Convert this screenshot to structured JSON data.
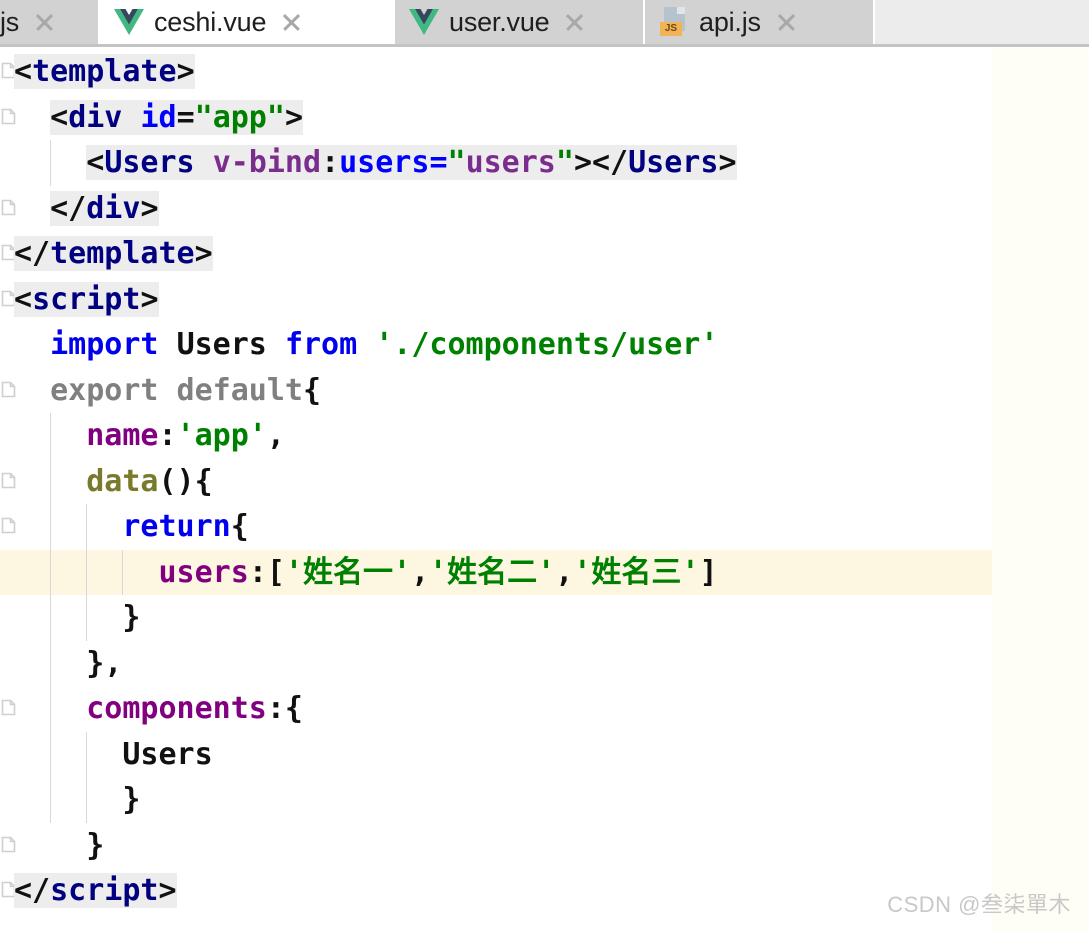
{
  "tabs": [
    {
      "label": "js",
      "icon": "partial-tab",
      "active": false,
      "partial": true,
      "closable": true
    },
    {
      "label": "ceshi.vue",
      "icon": "vue-icon",
      "active": true,
      "partial": false,
      "closable": true
    },
    {
      "label": "user.vue",
      "icon": "vue-icon",
      "active": false,
      "partial": false,
      "closable": true
    },
    {
      "label": "api.js",
      "icon": "js-icon",
      "active": false,
      "partial": false,
      "closable": true
    }
  ],
  "editor": {
    "language": "vue",
    "highlighted_line": 9,
    "lines": [
      {
        "n": 1,
        "fold": true,
        "indent_guides": [],
        "highlight": false,
        "tokens": [
          {
            "t": "<",
            "c": "bracket",
            "bg": true
          },
          {
            "t": "template",
            "c": "tag",
            "bg": true
          },
          {
            "t": ">",
            "c": "bracket",
            "bg": true
          }
        ]
      },
      {
        "n": 2,
        "fold": true,
        "indent_guides": [],
        "highlight": false,
        "tokens": [
          {
            "t": "  ",
            "c": "plain"
          },
          {
            "t": "<",
            "c": "bracket",
            "bg": true
          },
          {
            "t": "div",
            "c": "tag",
            "bg": true
          },
          {
            "t": " ",
            "c": "plain",
            "bg": true
          },
          {
            "t": "id",
            "c": "attr",
            "bg": true
          },
          {
            "t": "=",
            "c": "punct",
            "bg": true
          },
          {
            "t": "\"",
            "c": "attrval",
            "bg": true
          },
          {
            "t": "app",
            "c": "attrval",
            "bg": true
          },
          {
            "t": "\"",
            "c": "attrval",
            "bg": true
          },
          {
            "t": ">",
            "c": "bracket",
            "bg": true
          }
        ]
      },
      {
        "n": 3,
        "fold": false,
        "indent_guides": [
          1
        ],
        "highlight": false,
        "tokens": [
          {
            "t": "    ",
            "c": "plain"
          },
          {
            "t": "<",
            "c": "bracket",
            "bg": true
          },
          {
            "t": "Users",
            "c": "tag",
            "bg": true
          },
          {
            "t": " ",
            "c": "plain",
            "bg": true
          },
          {
            "t": "v-bind",
            "c": "directive",
            "bg": true
          },
          {
            "t": ":",
            "c": "punct",
            "bg": true
          },
          {
            "t": "users",
            "c": "attr",
            "bg": true
          },
          {
            "t": "=",
            "c": "attr",
            "bg": true
          },
          {
            "t": "\"",
            "c": "attrval",
            "bg": true
          },
          {
            "t": "users",
            "c": "dirval",
            "bg": true
          },
          {
            "t": "\"",
            "c": "attrval",
            "bg": true
          },
          {
            "t": ">",
            "c": "bracket",
            "bg": true
          },
          {
            "t": "</",
            "c": "bracket",
            "bg": true
          },
          {
            "t": "Users",
            "c": "tag",
            "bg": true
          },
          {
            "t": ">",
            "c": "bracket",
            "bg": true
          }
        ]
      },
      {
        "n": 4,
        "fold": true,
        "indent_guides": [],
        "highlight": false,
        "tokens": [
          {
            "t": "  ",
            "c": "plain"
          },
          {
            "t": "</",
            "c": "bracket",
            "bg": true
          },
          {
            "t": "div",
            "c": "tag",
            "bg": true
          },
          {
            "t": ">",
            "c": "bracket",
            "bg": true
          }
        ]
      },
      {
        "n": 5,
        "fold": true,
        "indent_guides": [],
        "highlight": false,
        "tokens": [
          {
            "t": "</",
            "c": "bracket",
            "bg": true
          },
          {
            "t": "template",
            "c": "tag",
            "bg": true
          },
          {
            "t": ">",
            "c": "bracket",
            "bg": true
          }
        ]
      },
      {
        "n": 6,
        "fold": true,
        "indent_guides": [],
        "highlight": false,
        "tokens": [
          {
            "t": "<",
            "c": "bracket",
            "bg": true
          },
          {
            "t": "script",
            "c": "tag",
            "bg": true
          },
          {
            "t": ">",
            "c": "bracket",
            "bg": true
          }
        ]
      },
      {
        "n": 7,
        "fold": false,
        "indent_guides": [],
        "highlight": false,
        "tokens": [
          {
            "t": "  ",
            "c": "plain"
          },
          {
            "t": "import",
            "c": "kw"
          },
          {
            "t": " ",
            "c": "plain"
          },
          {
            "t": "Users",
            "c": "plain"
          },
          {
            "t": " ",
            "c": "plain"
          },
          {
            "t": "from",
            "c": "kw"
          },
          {
            "t": " ",
            "c": "plain"
          },
          {
            "t": "'./components/user'",
            "c": "str"
          }
        ]
      },
      {
        "n": 8,
        "fold": true,
        "indent_guides": [],
        "highlight": false,
        "tokens": [
          {
            "t": "  ",
            "c": "plain"
          },
          {
            "t": "export default",
            "c": "dim"
          },
          {
            "t": "{",
            "c": "punct"
          }
        ]
      },
      {
        "n": 9,
        "fold": false,
        "indent_guides": [
          1
        ],
        "highlight": false,
        "tokens": [
          {
            "t": "    ",
            "c": "plain"
          },
          {
            "t": "name",
            "c": "prop"
          },
          {
            "t": ":",
            "c": "punct"
          },
          {
            "t": "'app'",
            "c": "str"
          },
          {
            "t": ",",
            "c": "punct"
          }
        ]
      },
      {
        "n": 10,
        "fold": true,
        "indent_guides": [
          1
        ],
        "highlight": false,
        "tokens": [
          {
            "t": "    ",
            "c": "plain"
          },
          {
            "t": "data",
            "c": "fn"
          },
          {
            "t": "(){",
            "c": "punct"
          }
        ]
      },
      {
        "n": 11,
        "fold": true,
        "indent_guides": [
          1,
          2
        ],
        "highlight": false,
        "tokens": [
          {
            "t": "      ",
            "c": "plain"
          },
          {
            "t": "return",
            "c": "kw"
          },
          {
            "t": "{",
            "c": "punct"
          }
        ]
      },
      {
        "n": 12,
        "fold": false,
        "indent_guides": [
          1,
          2,
          3
        ],
        "highlight": true,
        "tokens": [
          {
            "t": "        ",
            "c": "plain"
          },
          {
            "t": "users",
            "c": "prop"
          },
          {
            "t": ":[",
            "c": "punct"
          },
          {
            "t": "'姓名一'",
            "c": "str"
          },
          {
            "t": ",",
            "c": "punct"
          },
          {
            "t": "'姓名二'",
            "c": "str"
          },
          {
            "t": ",",
            "c": "punct"
          },
          {
            "t": "'姓名三'",
            "c": "str"
          },
          {
            "t": "]",
            "c": "punct"
          }
        ]
      },
      {
        "n": 13,
        "fold": false,
        "indent_guides": [
          1,
          2
        ],
        "highlight": false,
        "tokens": [
          {
            "t": "      }",
            "c": "punct"
          }
        ]
      },
      {
        "n": 14,
        "fold": false,
        "indent_guides": [
          1
        ],
        "highlight": false,
        "tokens": [
          {
            "t": "    },",
            "c": "punct"
          }
        ]
      },
      {
        "n": 15,
        "fold": true,
        "indent_guides": [
          1
        ],
        "highlight": false,
        "tokens": [
          {
            "t": "    ",
            "c": "plain"
          },
          {
            "t": "components",
            "c": "prop"
          },
          {
            "t": ":{",
            "c": "punct"
          }
        ]
      },
      {
        "n": 16,
        "fold": false,
        "indent_guides": [
          1,
          2
        ],
        "highlight": false,
        "tokens": [
          {
            "t": "      ",
            "c": "plain"
          },
          {
            "t": "Users",
            "c": "plain"
          }
        ]
      },
      {
        "n": 17,
        "fold": false,
        "indent_guides": [
          1,
          2
        ],
        "highlight": false,
        "tokens": [
          {
            "t": "      }",
            "c": "punct"
          }
        ]
      },
      {
        "n": 18,
        "fold": true,
        "indent_guides": [],
        "highlight": false,
        "tokens": [
          {
            "t": "    }",
            "c": "punct"
          }
        ]
      },
      {
        "n": 19,
        "fold": true,
        "indent_guides": [],
        "highlight": false,
        "tokens": [
          {
            "t": "</",
            "c": "bracket",
            "bg": true
          },
          {
            "t": "script",
            "c": "tag",
            "bg": true
          },
          {
            "t": ">",
            "c": "bracket",
            "bg": true
          }
        ]
      }
    ]
  },
  "watermark": {
    "text": "CSDN @叁柒單木"
  },
  "colors": {
    "tag": "#000080",
    "attribute": "#0000ff",
    "attribute_value": "#008000",
    "directive": "#7b2d8e",
    "keyword": "#0000ee",
    "property": "#800080",
    "string": "#008000",
    "function": "#7a7a2d",
    "dimmed": "#808080",
    "highlight_line": "#fdf7e2",
    "tag_background": "#ededed",
    "right_panel": "#fffef4",
    "tab_inactive": "#d2d2d2",
    "tab_active": "#ffffff"
  }
}
